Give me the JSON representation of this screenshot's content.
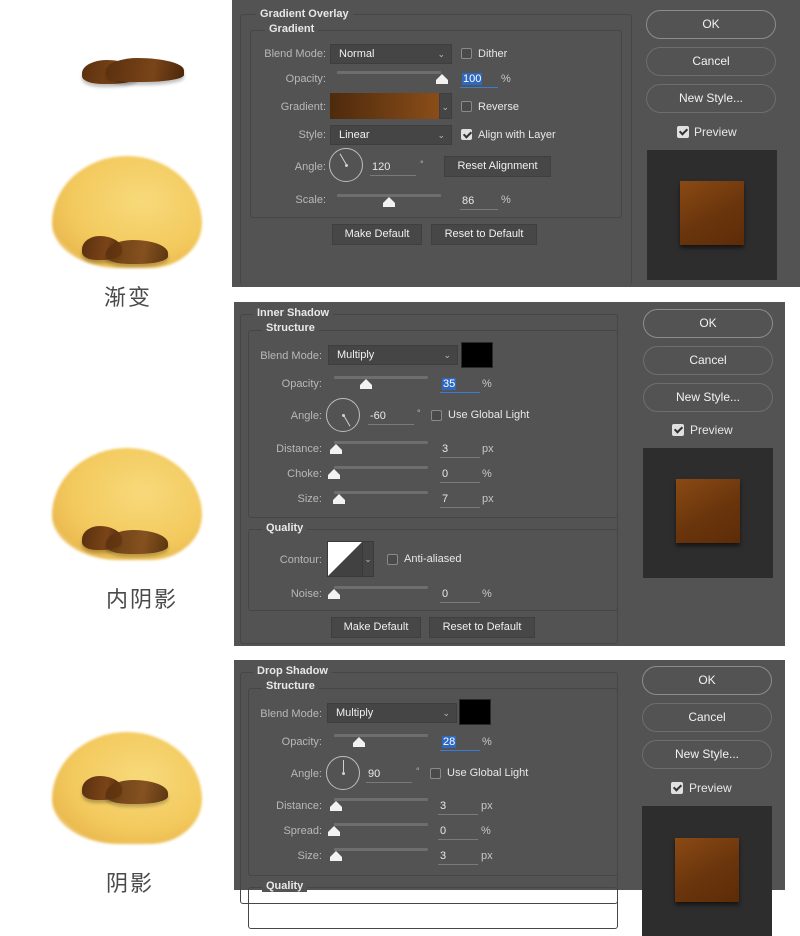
{
  "illustrations": [
    {
      "caption": "渐变"
    },
    {
      "caption": "内阴影"
    },
    {
      "caption": "阴影"
    }
  ],
  "gradient_overlay": {
    "title": "Gradient Overlay",
    "group_title": "Gradient",
    "blend_mode_label": "Blend Mode:",
    "blend_mode_value": "Normal",
    "dither_label": "Dither",
    "dither_checked": false,
    "opacity_label": "Opacity:",
    "opacity_value": "100",
    "opacity_fraction": 1.0,
    "opacity_unit": "%",
    "gradient_label": "Gradient:",
    "gradient_colors": [
      "#4e2a0d",
      "#8a4d18"
    ],
    "reverse_label": "Reverse",
    "reverse_checked": false,
    "style_label": "Style:",
    "style_value": "Linear",
    "align_label": "Align with Layer",
    "align_checked": true,
    "angle_label": "Angle:",
    "angle_value": "120",
    "angle_unit": "°",
    "reset_alignment_label": "Reset Alignment",
    "scale_label": "Scale:",
    "scale_value": "86",
    "scale_fraction": 0.5,
    "scale_unit": "%",
    "make_default_label": "Make Default",
    "reset_default_label": "Reset to Default"
  },
  "inner_shadow": {
    "title": "Inner Shadow",
    "group_title": "Structure",
    "blend_mode_label": "Blend Mode:",
    "blend_mode_value": "Multiply",
    "shadow_color": "#000000",
    "opacity_label": "Opacity:",
    "opacity_value": "35",
    "opacity_fraction": 0.35,
    "opacity_unit": "%",
    "angle_label": "Angle:",
    "angle_value": "-60",
    "angle_unit": "°",
    "global_light_label": "Use Global Light",
    "global_light_checked": false,
    "distance_label": "Distance:",
    "distance_value": "3",
    "distance_unit": "px",
    "choke_label": "Choke:",
    "choke_value": "0",
    "choke_unit": "%",
    "size_label": "Size:",
    "size_value": "7",
    "size_unit": "px",
    "quality_title": "Quality",
    "contour_label": "Contour:",
    "anti_aliased_label": "Anti-aliased",
    "anti_aliased_checked": false,
    "noise_label": "Noise:",
    "noise_value": "0",
    "noise_unit": "%",
    "make_default_label": "Make Default",
    "reset_default_label": "Reset to Default"
  },
  "drop_shadow": {
    "title": "Drop Shadow",
    "group_title": "Structure",
    "blend_mode_label": "Blend Mode:",
    "blend_mode_value": "Multiply",
    "shadow_color": "#000000",
    "opacity_label": "Opacity:",
    "opacity_value": "28",
    "opacity_fraction": 0.28,
    "opacity_unit": "%",
    "angle_label": "Angle:",
    "angle_value": "90",
    "angle_unit": "°",
    "global_light_label": "Use Global Light",
    "global_light_checked": false,
    "distance_label": "Distance:",
    "distance_value": "3",
    "distance_unit": "px",
    "spread_label": "Spread:",
    "spread_value": "0",
    "spread_unit": "%",
    "size_label": "Size:",
    "size_value": "3",
    "size_unit": "px",
    "quality_title": "Quality"
  },
  "side_buttons": {
    "ok_label": "OK",
    "cancel_label": "Cancel",
    "new_style_label": "New Style...",
    "preview_label": "Preview",
    "preview_checked": true
  }
}
